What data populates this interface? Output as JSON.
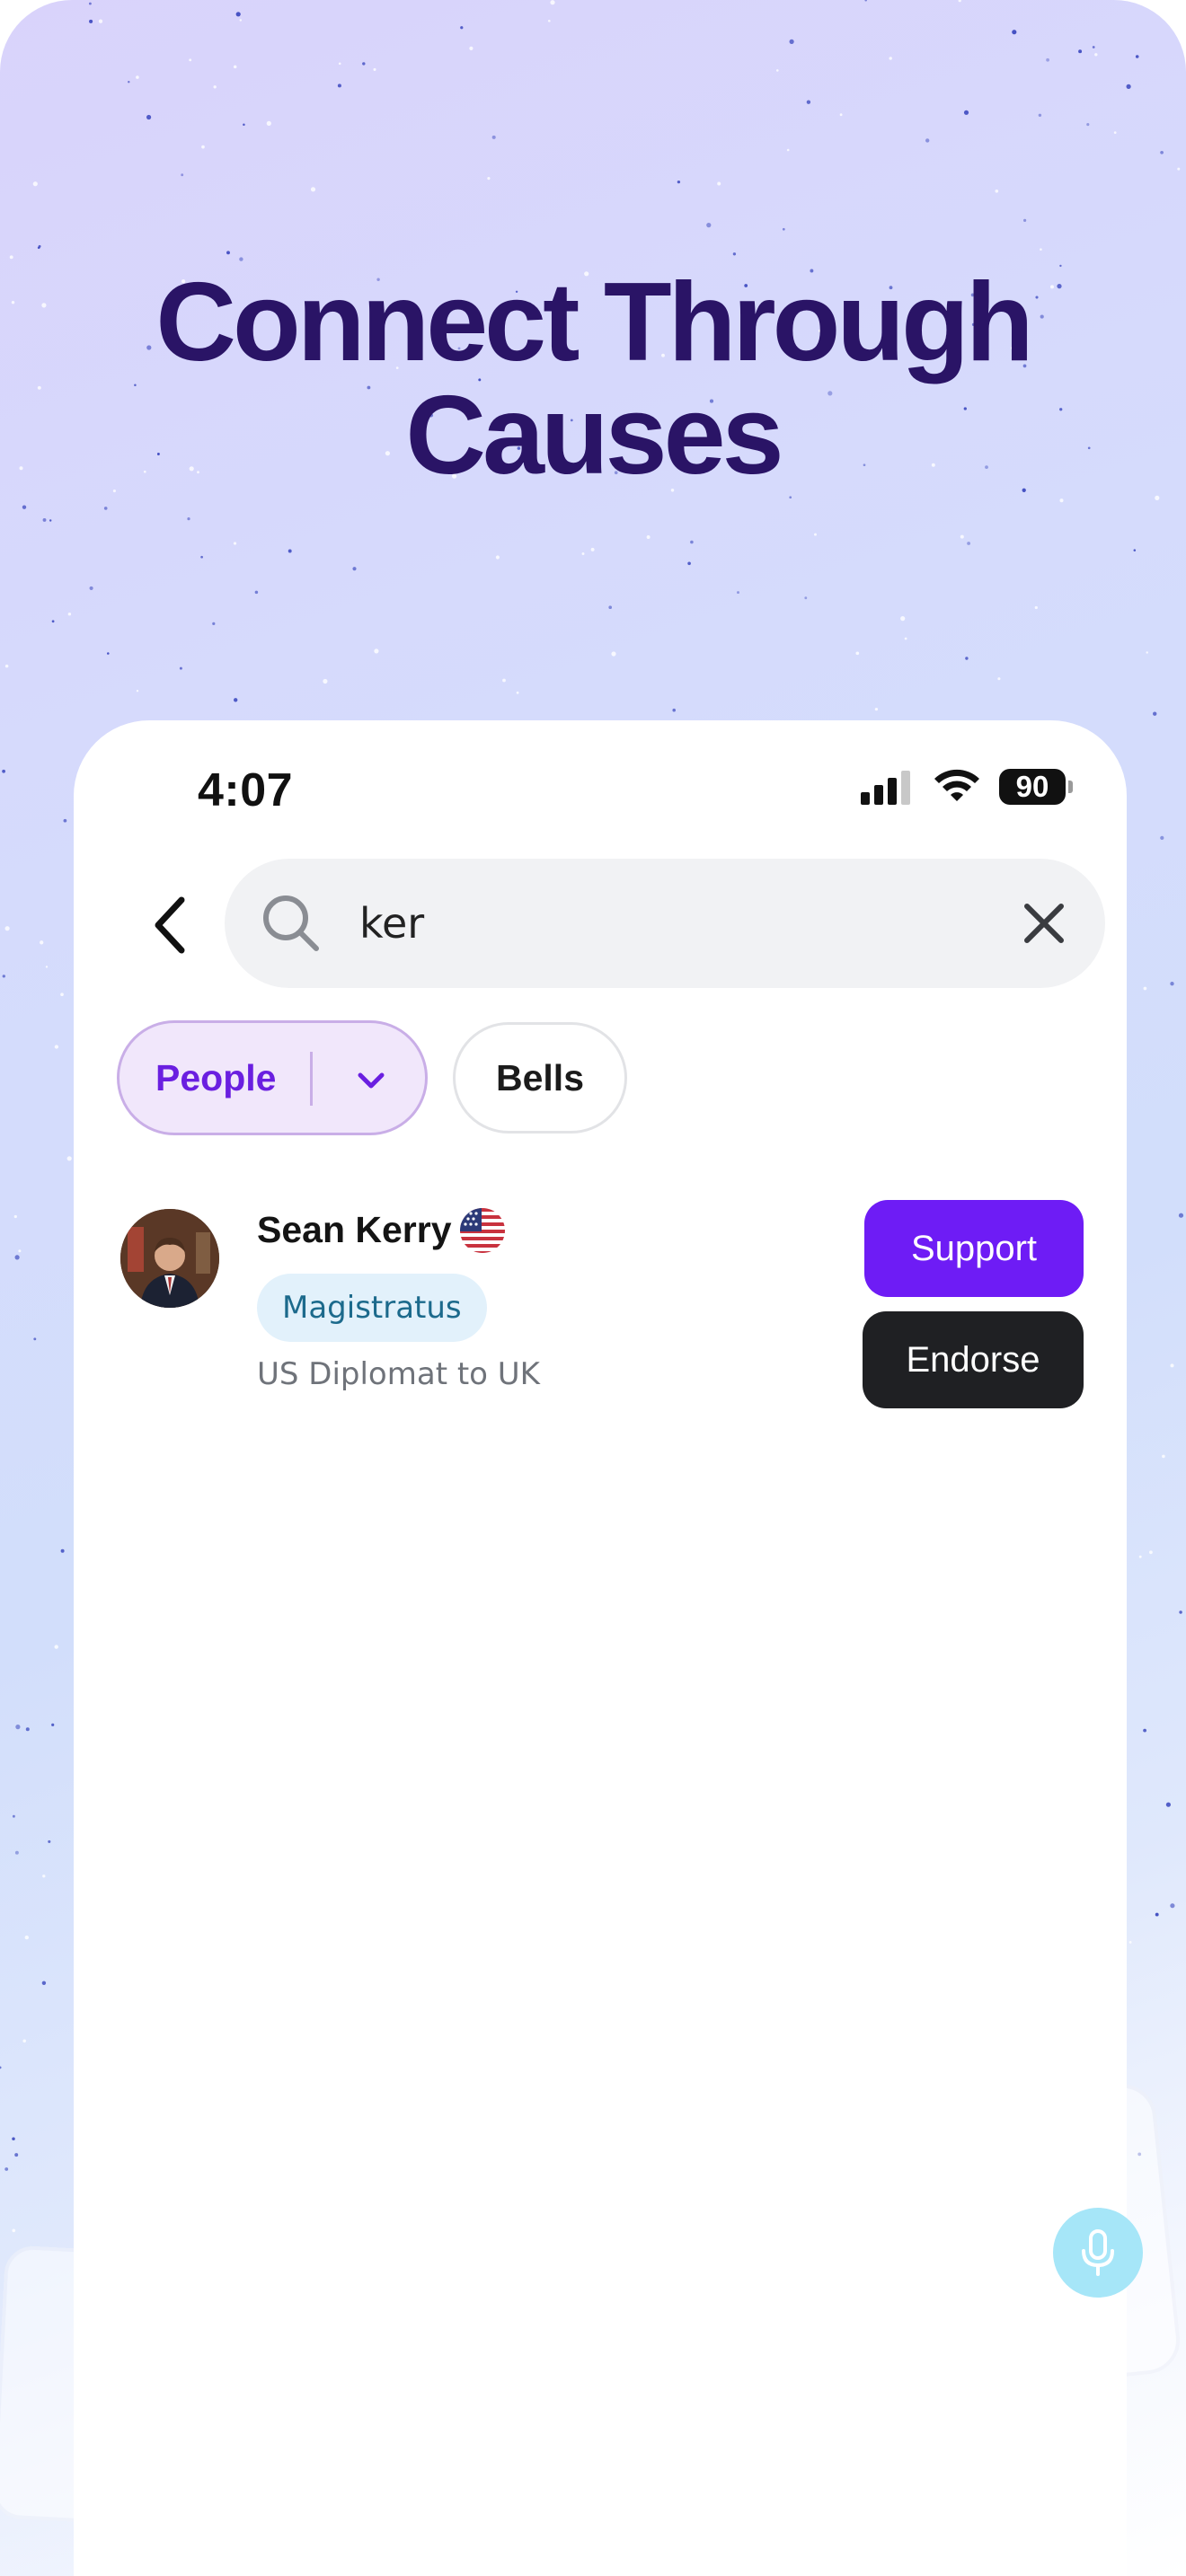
{
  "promo": {
    "headline_line1": "Connect Through",
    "headline_line2": "Causes"
  },
  "status_bar": {
    "time": "4:07",
    "battery": "90",
    "icons": [
      "cellular-signal-icon",
      "wifi-icon",
      "battery-icon"
    ]
  },
  "search": {
    "query": "ker",
    "icons": [
      "back-chevron-icon",
      "search-icon",
      "close-icon"
    ]
  },
  "filters": {
    "people_label": "People",
    "bells_label": "Bells",
    "selected": "People"
  },
  "results": [
    {
      "name": "Sean Kerry",
      "flag": "us-flag-icon",
      "role": "Magistratus",
      "description": "US Diplomat to UK",
      "support_label": "Support",
      "endorse_label": "Endorse"
    }
  ],
  "colors": {
    "headline": "#2a1466",
    "accent_purple": "#6e1cf5",
    "chip_active_bg": "#f1e7fb",
    "dark_button": "#1f2023",
    "badge_bg": "#e2f1fb",
    "badge_text": "#1c6a8c",
    "mic_button": "#a6e6f8"
  }
}
